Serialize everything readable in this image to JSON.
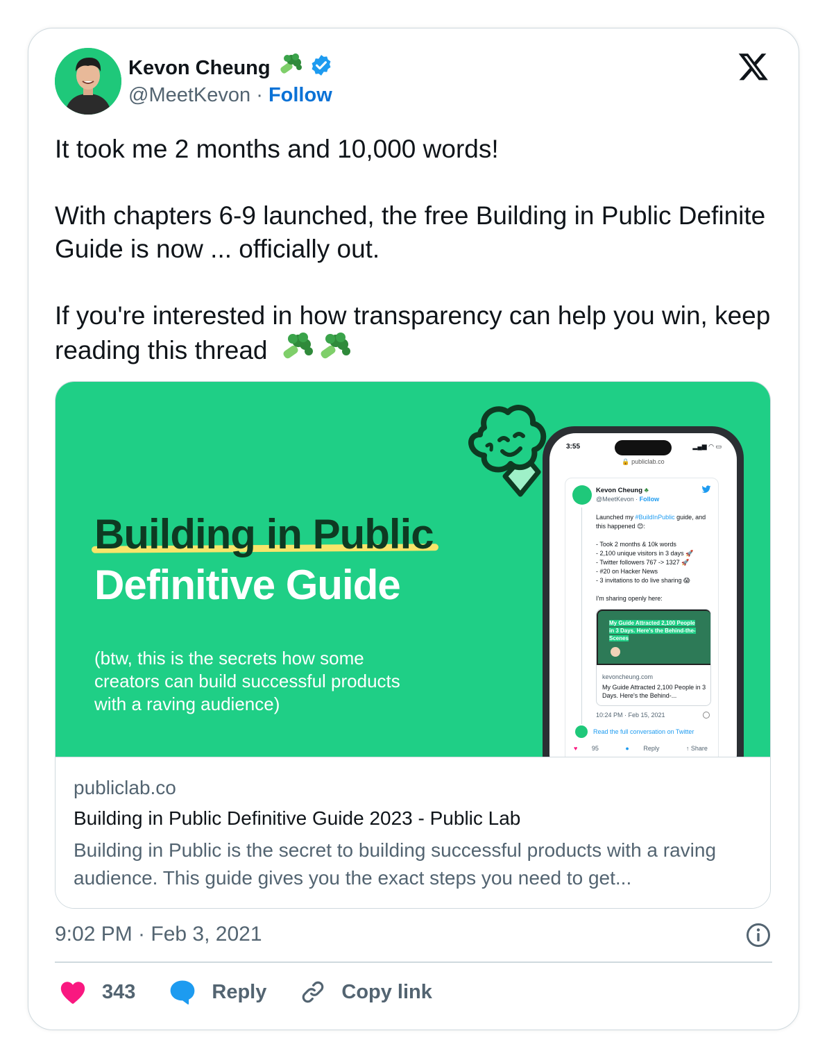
{
  "user": {
    "display_name": "Kevon Cheung",
    "handle": "@MeetKevon",
    "separator": "·",
    "follow_label": "Follow"
  },
  "tweet": {
    "line1": "It took me 2 months and 10,000 words!",
    "line2": "With chapters 6-9 launched, the free Building in Public Definite Guide is now ... officially out.",
    "line3": "If you're interested in how transparency can help you win, keep reading this thread"
  },
  "preview": {
    "title1": "Building in Public",
    "title2": "Definitive Guide",
    "subtitle": "(btw, this is the secrets how some creators can build successful products with a raving audience)",
    "phone": {
      "time": "3:55",
      "url": "publiclab.co",
      "name": "Kevon Cheung",
      "handle": "@MeetKevon",
      "follow": "Follow",
      "text_prefix": "Launched my ",
      "hashtag": "#BuildInPublic",
      "text_suffix": " guide, and this happened",
      "bullets": [
        "- Took 2 months & 10k words",
        "- 2,100 unique visitors in 3 days 🚀",
        "- Twitter followers 767 -> 1327 🚀",
        "- #20 on Hacker News",
        "- 3 invitations to do live sharing 😱"
      ],
      "sharing": "I'm sharing openly here:",
      "card_headline": "My Guide Attracted 2,100 People in 3 Days. Here's the Behind-the-Scenes",
      "card_domain": "kevoncheung.com",
      "card_title": "My Guide Attracted 2,100 People in 3 Days. Here's the Behind-...",
      "time_stamp": "10:24 PM · Feb 15, 2021",
      "read_more": "Read the full conversation on Twitter",
      "likes": "95",
      "reply": "Reply",
      "share": "Share"
    }
  },
  "link": {
    "domain": "publiclab.co",
    "title": "Building in Public Definitive Guide 2023 - Public Lab",
    "description": "Building in Public is the secret to building successful products with a raving audience. This guide gives you the exact steps you need to get..."
  },
  "footer": {
    "timestamp": "9:02 PM · Feb 3, 2021",
    "likes": "343",
    "reply_label": "Reply",
    "copy_label": "Copy link"
  },
  "colors": {
    "accent": "#0b72d6",
    "brand_green": "#1fcf86",
    "heart": "#f91880",
    "reply_bubble": "#1d9bf0"
  },
  "icons": [
    "verified-badge-icon",
    "broccoli-emoji-icon",
    "x-logo-icon",
    "info-icon",
    "heart-icon",
    "reply-bubble-icon",
    "link-icon"
  ]
}
